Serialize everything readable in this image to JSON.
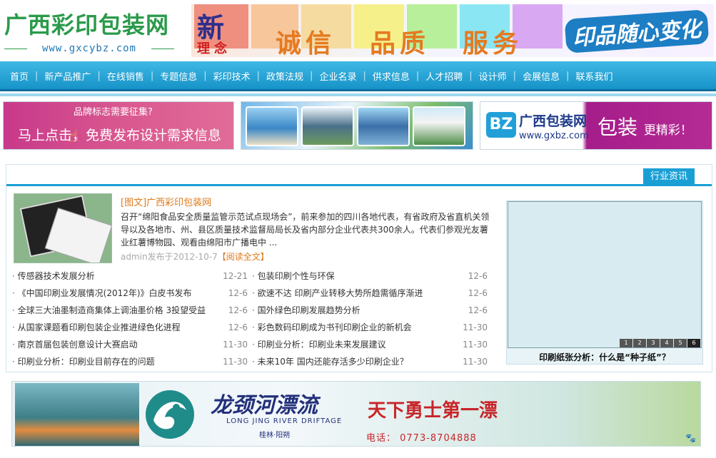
{
  "header": {
    "logo_title": "广西彩印包装网",
    "logo_url": "www.gxcybz.com",
    "banner": {
      "new": "新",
      "concept": "理念",
      "words": [
        "诚信",
        "品质",
        "服务"
      ],
      "slogan": "印品随心变化"
    }
  },
  "nav": {
    "items": [
      "首页",
      "新产品推广",
      "在线销售",
      "专题信息",
      "彩印技术",
      "政策法规",
      "企业名录",
      "供求信息",
      "人才招聘",
      "设计师",
      "会展信息",
      "联系我们"
    ],
    "separator": "|"
  },
  "ads": {
    "ad1": {
      "question": "品牌标志需要征集?",
      "message": "马上点击，免费发布设计需求信息"
    },
    "ad3": {
      "badge": "BZ",
      "name": "广西包装网",
      "domain": "www.gxbz.com",
      "slogan_big": "包装",
      "slogan_small": "更精彩！"
    }
  },
  "news": {
    "tab": "行业资讯",
    "feature": {
      "tag": "[图文]",
      "title": "广西彩印包装网",
      "body": "召开“绵阳食品安全质量监管示范试点现场会”，前来参加的四川各地代表，有省政府及省直机关领导以及各地市、州、县区质量技术监督局局长及省内部分企业代表共300余人。代表们参观光友薯业红薯博物园、观看由绵阳市广播电中 ...",
      "meta": "admin发布于2012-10-7",
      "read_more": "【阅读全文】"
    },
    "left_list": [
      {
        "title": "传感器技术发展分析",
        "date": "12-21"
      },
      {
        "title": "《中国印刷业发展情况(2012年)》白皮书发布",
        "date": "12-6"
      },
      {
        "title": "全球三大油墨制造商集体上调油墨价格 3投望受益",
        "date": "12-6"
      },
      {
        "title": "从国家课题看印刷包装企业推进绿色化进程",
        "date": "12-6"
      },
      {
        "title": "南京首届包装创意设计大赛启动",
        "date": "11-30"
      },
      {
        "title": "印刷业分析：印刷业目前存在的问题",
        "date": "11-30"
      }
    ],
    "right_list": [
      {
        "title": "包装印刷个性与环保",
        "date": "12-6"
      },
      {
        "title": "欲速不达 印刷产业转移大势所趋需循序渐进",
        "date": "12-6"
      },
      {
        "title": "国外绿色印刷发展趋势分析",
        "date": "12-6"
      },
      {
        "title": "彩色数码印刷成为书刊印刷企业的新机会",
        "date": "11-30"
      },
      {
        "title": "印刷业分析：印刷业未来发展建议",
        "date": "11-30"
      },
      {
        "title": "未来10年 国内还能存活多少印刷企业？",
        "date": "11-30"
      }
    ],
    "slideshow": {
      "pages": [
        "1",
        "2",
        "3",
        "4",
        "5",
        "6"
      ],
      "caption": "印刷纸张分析：什么是“种子纸”？"
    }
  },
  "bottom_banner": {
    "cn": "龙颈河漂流",
    "en": "LONG JING RIVER DRIFTAGE",
    "location": "桂林·阳朔",
    "slogan": "天下勇士第一漂",
    "tel": "电话： 0773-8704888"
  }
}
